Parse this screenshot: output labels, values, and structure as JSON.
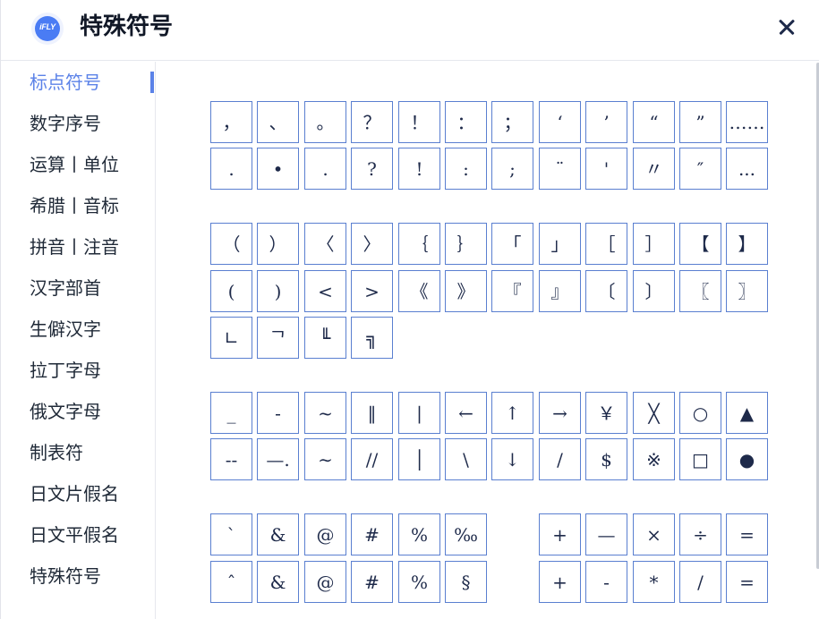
{
  "header": {
    "logo_text": "iFLY",
    "title": "特殊符号",
    "close_icon": "close-icon"
  },
  "sidebar": {
    "active_index": 0,
    "items": [
      {
        "label": "标点符号"
      },
      {
        "label": "数字序号"
      },
      {
        "label": "运算丨单位"
      },
      {
        "label": "希腊丨音标"
      },
      {
        "label": "拼音丨注音"
      },
      {
        "label": "汉字部首"
      },
      {
        "label": "生僻汉字"
      },
      {
        "label": "拉丁字母"
      },
      {
        "label": "俄文字母"
      },
      {
        "label": "制表符"
      },
      {
        "label": "日文片假名"
      },
      {
        "label": "日文平假名"
      },
      {
        "label": "特殊符号"
      }
    ]
  },
  "symbols": {
    "group1": {
      "row1": [
        "，",
        "、",
        "。",
        "？",
        "！",
        "：",
        "；",
        "‘",
        "’",
        "“",
        "”",
        "……"
      ],
      "row2": [
        ".",
        "•",
        ".",
        "?",
        "!",
        ":",
        ";",
        "¨",
        "'",
        "〃",
        "″",
        "..."
      ]
    },
    "group2": {
      "row1": [
        "（",
        "）",
        "〈",
        "〉",
        "｛",
        "｝",
        "「",
        "」",
        "［",
        "］",
        "【",
        "】"
      ],
      "row2": [
        "(",
        ")",
        "<",
        ">",
        "《",
        "》",
        "『",
        "』",
        "〔",
        "〕",
        "〖",
        "〗"
      ],
      "row3": [
        "∟",
        "ᄀ",
        "╙",
        "╗"
      ]
    },
    "group3": {
      "row1": [
        "_",
        "-",
        "~",
        "‖",
        "|",
        "←",
        "↑",
        "→",
        "￥",
        "╳",
        "○",
        "▲"
      ],
      "row2": [
        "--",
        "—.",
        "∼",
        "//",
        "│",
        "\\",
        "↓",
        "/",
        "$",
        "※",
        "□",
        "●"
      ]
    },
    "group4": {
      "row1_left": [
        "`",
        "&",
        "@",
        "#",
        "%",
        "‰"
      ],
      "row1_right": [
        "+",
        "—",
        "×",
        "÷",
        "="
      ],
      "row2_left": [
        "ˆ",
        "&",
        "@",
        "#",
        "%",
        "§"
      ],
      "row2_right": [
        "+",
        "-",
        "*",
        "/",
        "="
      ]
    }
  }
}
